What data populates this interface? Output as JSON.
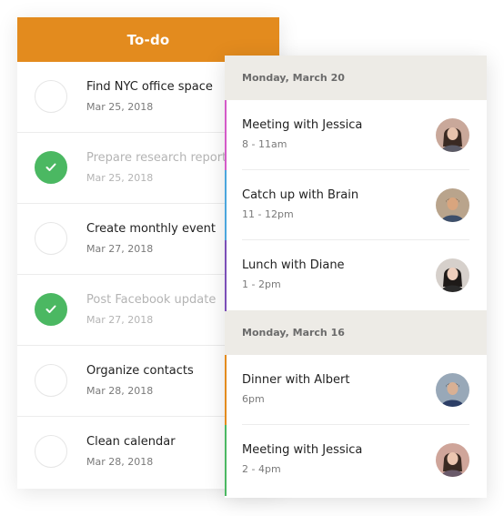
{
  "todo": {
    "title": "To-do",
    "header_color": "#e38b1e",
    "done_color": "#4bb862",
    "items": [
      {
        "title": "Find NYC office space",
        "date": "Mar 25, 2018",
        "done": false
      },
      {
        "title": "Prepare research report",
        "date": "Mar 25, 2018",
        "done": true
      },
      {
        "title": "Create monthly event",
        "date": "Mar 27, 2018",
        "done": false
      },
      {
        "title": "Post Facebook update",
        "date": "Mar 27, 2018",
        "done": true
      },
      {
        "title": "Organize contacts",
        "date": "Mar 28, 2018",
        "done": false
      },
      {
        "title": "Clean calendar",
        "date": "Mar 28, 2018",
        "done": false
      }
    ]
  },
  "calendar": {
    "days": [
      {
        "label": "Monday, March 20",
        "events": [
          {
            "title": "Meeting with Jessica",
            "time": "8 - 11am",
            "color": "#d45ac8",
            "avatar": "woman-avatar-icon"
          },
          {
            "title": "Catch up with Brain",
            "time": "11 - 12pm",
            "color": "#4aa6dd",
            "avatar": "man-avatar-icon"
          },
          {
            "title": "Lunch with Diane",
            "time": "1 - 2pm",
            "color": "#7b4fb8",
            "avatar": "woman-avatar-icon"
          }
        ]
      },
      {
        "label": "Monday, March 16",
        "events": [
          {
            "title": "Dinner with Albert",
            "time": "6pm",
            "color": "#e38b1e",
            "avatar": "man-avatar-icon"
          },
          {
            "title": "Meeting with Jessica",
            "time": "2 - 4pm",
            "color": "#4bb862",
            "avatar": "woman-avatar-icon"
          }
        ]
      }
    ]
  }
}
